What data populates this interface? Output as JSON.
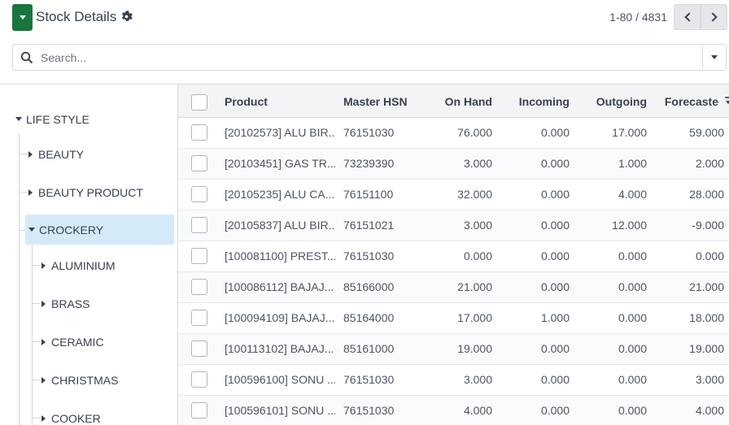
{
  "header": {
    "title": "Stock Details",
    "pager": "1-80 / 4831"
  },
  "search": {
    "placeholder": "Search..."
  },
  "tree": {
    "root": "LIFE STYLE",
    "categories": [
      "BEAUTY",
      "BEAUTY PRODUCT",
      "CROCKERY"
    ],
    "active": "CROCKERY",
    "subcategories": [
      "ALUMINIUM",
      "BRASS",
      "CERAMIC",
      "CHRISTMAS",
      "COOKER"
    ]
  },
  "table": {
    "columns": [
      "Product",
      "Master HSN",
      "On Hand",
      "Incoming",
      "Outgoing",
      "Forecaste"
    ],
    "rows": [
      {
        "product": "[20102573] ALU BIR...",
        "hsn": "76151030",
        "on_hand": "76.000",
        "incoming": "0.000",
        "outgoing": "17.000",
        "forecast": "59.000"
      },
      {
        "product": "[20103451] GAS TR...",
        "hsn": "73239390",
        "on_hand": "3.000",
        "incoming": "0.000",
        "outgoing": "1.000",
        "forecast": "2.000"
      },
      {
        "product": "[20105235] ALU CA...",
        "hsn": "76151100",
        "on_hand": "32.000",
        "incoming": "0.000",
        "outgoing": "4.000",
        "forecast": "28.000"
      },
      {
        "product": "[20105837] ALU BIR...",
        "hsn": "76151021",
        "on_hand": "3.000",
        "incoming": "0.000",
        "outgoing": "12.000",
        "forecast": "-9.000"
      },
      {
        "product": "[100081100] PREST...",
        "hsn": "76151030",
        "on_hand": "0.000",
        "incoming": "0.000",
        "outgoing": "0.000",
        "forecast": "0.000"
      },
      {
        "product": "[100086112] BAJAJ...",
        "hsn": "85166000",
        "on_hand": "21.000",
        "incoming": "0.000",
        "outgoing": "0.000",
        "forecast": "21.000"
      },
      {
        "product": "[100094109] BAJAJ...",
        "hsn": "85164000",
        "on_hand": "17.000",
        "incoming": "1.000",
        "outgoing": "0.000",
        "forecast": "18.000"
      },
      {
        "product": "[100113102] BAJAJ...",
        "hsn": "85161000",
        "on_hand": "19.000",
        "incoming": "0.000",
        "outgoing": "0.000",
        "forecast": "19.000"
      },
      {
        "product": "[100596100] SONU ...",
        "hsn": "76151030",
        "on_hand": "3.000",
        "incoming": "0.000",
        "outgoing": "0.000",
        "forecast": "3.000"
      },
      {
        "product": "[100596101] SONU ...",
        "hsn": "76151030",
        "on_hand": "4.000",
        "incoming": "0.000",
        "outgoing": "0.000",
        "forecast": "4.000"
      }
    ]
  },
  "colors": {
    "primary_button": "#17753d",
    "active_tree_item": "#d5eaf8",
    "header_bg": "#f3f4f6"
  },
  "icons": [
    "caret-down-icon",
    "gear-icon",
    "chevron-left-icon",
    "chevron-right-icon",
    "search-icon",
    "sort-icon"
  ]
}
